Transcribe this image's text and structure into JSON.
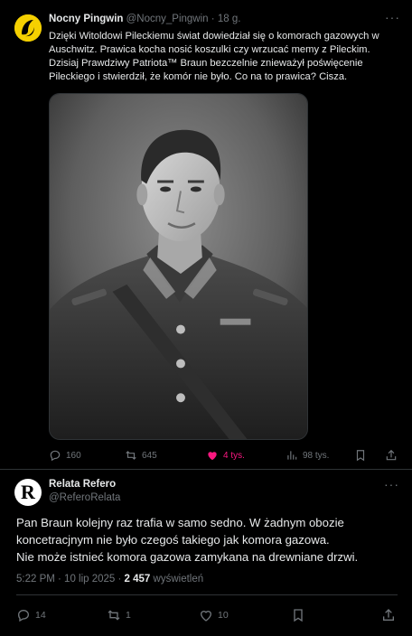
{
  "post1": {
    "author_name": "Nocny Pingwin",
    "author_handle": "@Nocny_Pingwin",
    "separator": "·",
    "time": "18 g.",
    "text": "Dzięki Witoldowi Pileckiemu świat dowiedział się o komorach gazowych w Auschwitz. Prawica kocha nosić koszulki czy wrzucać memy z Pileckim. Dzisiaj Prawdziwy Patriota™ Braun bezczelnie znieważył poświęcenie Pileckiego i stwierdził, że komór nie było. Co na to prawica? Cisza.",
    "image_icon": "portrait-photo",
    "replies": "160",
    "reposts": "645",
    "likes": "4 tys.",
    "views": "98 tys."
  },
  "post2": {
    "author_name": "Relata Refero",
    "author_handle": "@ReferoRelata",
    "avatar_letter": "R",
    "text_lines": [
      "Pan Braun kolejny raz trafia w samo sedno. W żadnym obozie",
      "koncetracjnym nie było czegoś takiego jak komora gazowa.",
      "Nie może istnieć komora gazowa zamykana na drewniane drzwi."
    ],
    "time": "5:22 PM · 10 lip 2025 ·",
    "views_count": "2 457",
    "views_label": "wyświetleń",
    "replies": "14",
    "reposts": "1",
    "likes": "10"
  },
  "colors": {
    "background": "#000000",
    "text": "#e7e9ea",
    "muted": "#71767b",
    "like_active": "#f91880",
    "divider": "#2f3336"
  }
}
